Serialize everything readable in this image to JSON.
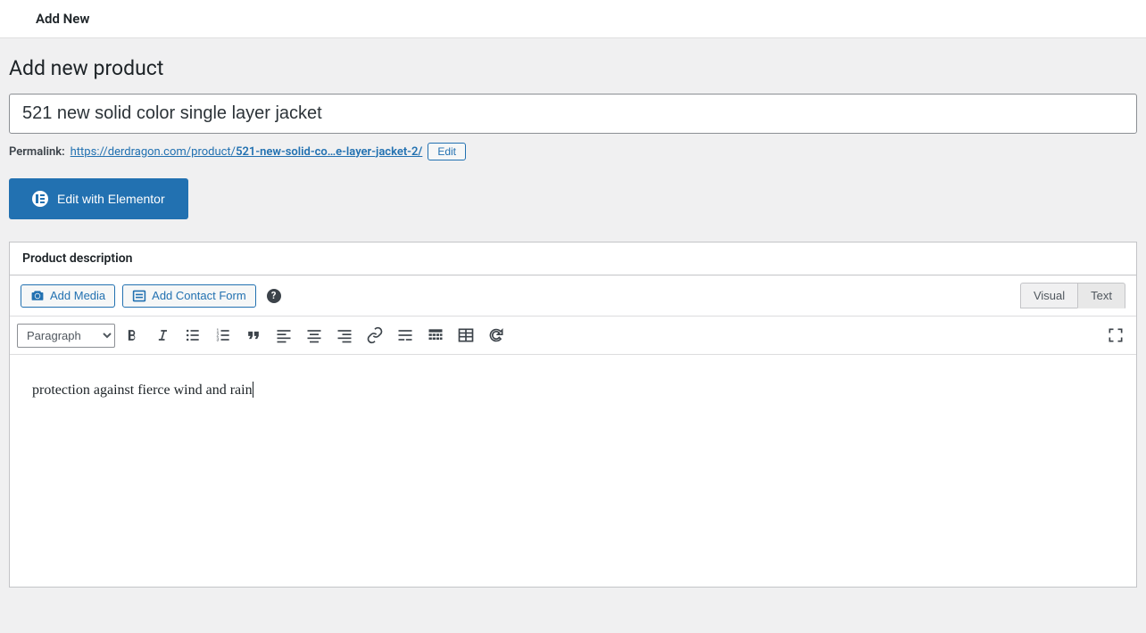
{
  "top_bar": {
    "title": "Add New"
  },
  "page": {
    "title": "Add new product"
  },
  "product": {
    "title_value": "521 new solid color single layer jacket"
  },
  "permalink": {
    "label": "Permalink:",
    "base": "https://derdragon.com/product/",
    "slug": "521-new-solid-co…e-layer-jacket-2/",
    "edit_label": "Edit"
  },
  "elementor": {
    "label": "Edit with Elementor"
  },
  "description_box": {
    "header": "Product description"
  },
  "media": {
    "add_media": "Add Media",
    "add_contact_form": "Add Contact Form"
  },
  "tabs": {
    "visual": "Visual",
    "text": "Text"
  },
  "toolbar": {
    "format_selected": "Paragraph"
  },
  "editor": {
    "content": "protection against fierce wind and rain"
  }
}
